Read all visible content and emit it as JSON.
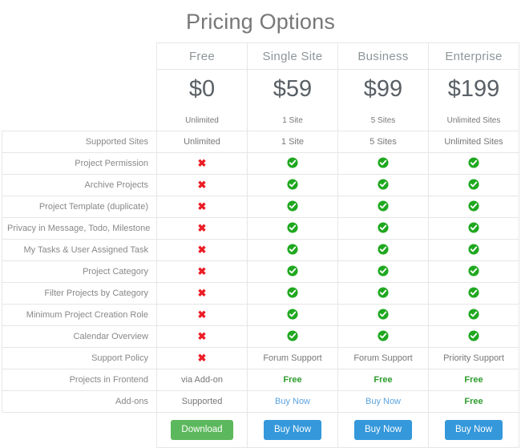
{
  "page": {
    "title": "Pricing Options"
  },
  "colors": {
    "title": "#777777",
    "check_green": "#1fa81f",
    "cross_red": "#ec1c24",
    "free_green": "#2e9c2e",
    "link_blue": "#5ba3e0",
    "button_green": "#5cb85c",
    "button_blue": "#3498db",
    "border": "#e6e6e6"
  },
  "table": {
    "plans": [
      {
        "name": "Free",
        "price": "$0",
        "sites": "Unlimited"
      },
      {
        "name": "Single Site",
        "price": "$59",
        "sites": "1 Site"
      },
      {
        "name": "Business",
        "price": "$99",
        "sites": "5 Sites"
      },
      {
        "name": "Enterprise",
        "price": "$199",
        "sites": "Unlimited Sites"
      }
    ],
    "rows": [
      {
        "label": "Supported Sites",
        "cells": [
          {
            "type": "text",
            "value": "Unlimited"
          },
          {
            "type": "text",
            "value": "1 Site"
          },
          {
            "type": "text",
            "value": "5 Sites"
          },
          {
            "type": "text",
            "value": "Unlimited Sites"
          }
        ]
      },
      {
        "label": "Project Permission",
        "cells": [
          {
            "type": "no"
          },
          {
            "type": "yes"
          },
          {
            "type": "yes"
          },
          {
            "type": "yes"
          }
        ]
      },
      {
        "label": "Archive Projects",
        "cells": [
          {
            "type": "no"
          },
          {
            "type": "yes"
          },
          {
            "type": "yes"
          },
          {
            "type": "yes"
          }
        ]
      },
      {
        "label": "Project Template (duplicate)",
        "cells": [
          {
            "type": "no"
          },
          {
            "type": "yes"
          },
          {
            "type": "yes"
          },
          {
            "type": "yes"
          }
        ]
      },
      {
        "label": "Privacy in Message, Todo, Milestone",
        "cells": [
          {
            "type": "no"
          },
          {
            "type": "yes"
          },
          {
            "type": "yes"
          },
          {
            "type": "yes"
          }
        ]
      },
      {
        "label": "My Tasks & User Assigned Task",
        "cells": [
          {
            "type": "no"
          },
          {
            "type": "yes"
          },
          {
            "type": "yes"
          },
          {
            "type": "yes"
          }
        ]
      },
      {
        "label": "Project Category",
        "cells": [
          {
            "type": "no"
          },
          {
            "type": "yes"
          },
          {
            "type": "yes"
          },
          {
            "type": "yes"
          }
        ]
      },
      {
        "label": "Filter Projects by Category",
        "cells": [
          {
            "type": "no"
          },
          {
            "type": "yes"
          },
          {
            "type": "yes"
          },
          {
            "type": "yes"
          }
        ]
      },
      {
        "label": "Minimum Project Creation Role",
        "cells": [
          {
            "type": "no"
          },
          {
            "type": "yes"
          },
          {
            "type": "yes"
          },
          {
            "type": "yes"
          }
        ]
      },
      {
        "label": "Calendar Overview",
        "cells": [
          {
            "type": "no"
          },
          {
            "type": "yes"
          },
          {
            "type": "yes"
          },
          {
            "type": "yes"
          }
        ]
      },
      {
        "label": "Support Policy",
        "cells": [
          {
            "type": "no"
          },
          {
            "type": "text",
            "value": "Forum Support"
          },
          {
            "type": "text",
            "value": "Forum Support"
          },
          {
            "type": "text",
            "value": "Priority Support"
          }
        ]
      },
      {
        "label": "Projects in Frontend",
        "cells": [
          {
            "type": "text",
            "value": "via Add-on"
          },
          {
            "type": "free",
            "value": "Free"
          },
          {
            "type": "free",
            "value": "Free"
          },
          {
            "type": "free",
            "value": "Free"
          }
        ]
      },
      {
        "label": "Add-ons",
        "cells": [
          {
            "type": "text",
            "value": "Supported"
          },
          {
            "type": "link",
            "value": "Buy Now"
          },
          {
            "type": "link",
            "value": "Buy Now"
          },
          {
            "type": "free",
            "value": "Free"
          }
        ]
      }
    ],
    "buttons": [
      {
        "label": "Download",
        "style": "green"
      },
      {
        "label": "Buy Now",
        "style": "blue"
      },
      {
        "label": "Buy Now",
        "style": "blue"
      },
      {
        "label": "Buy Now",
        "style": "blue"
      }
    ]
  },
  "icons": {
    "yes": "check-circle-icon",
    "no": "cross-icon"
  }
}
